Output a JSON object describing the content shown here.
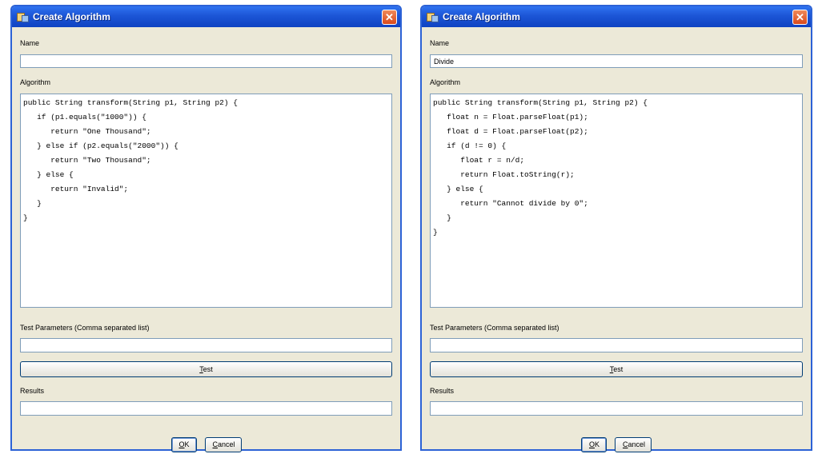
{
  "dialogs": [
    {
      "title": "Create Algorithm",
      "close_glyph": "✕",
      "name_label": "Name",
      "name_value": "",
      "algorithm_label": "Algorithm",
      "algorithm_code": "public String transform(String p1, String p2) {\n   if (p1.equals(\"1000\")) {\n      return \"One Thousand\";\n   } else if (p2.equals(\"2000\")) {\n      return \"Two Thousand\";\n   } else {\n      return \"Invalid\";\n   }\n}",
      "test_params_label": "Test Parameters (Comma separated list)",
      "test_params_value": "",
      "test_button": {
        "underlined": "T",
        "rest": "est"
      },
      "results_label": "Results",
      "results_value": "",
      "ok_button": {
        "underlined": "O",
        "rest": "K"
      },
      "cancel_button": {
        "underlined": "C",
        "rest": "ancel"
      }
    },
    {
      "title": "Create Algorithm",
      "close_glyph": "✕",
      "name_label": "Name",
      "name_value": "Divide",
      "algorithm_label": "Algorithm",
      "algorithm_code": "public String transform(String p1, String p2) {\n   float n = Float.parseFloat(p1);\n   float d = Float.parseFloat(p2);\n   if (d != 0) {\n      float r = n/d;\n      return Float.toString(r);\n   } else {\n      return \"Cannot divide by 0\";\n   }\n}",
      "test_params_label": "Test Parameters (Comma separated list)",
      "test_params_value": "",
      "test_button": {
        "underlined": "T",
        "rest": "est"
      },
      "results_label": "Results",
      "results_value": "",
      "ok_button": {
        "underlined": "O",
        "rest": "K"
      },
      "cancel_button": {
        "underlined": "C",
        "rest": "ancel"
      }
    }
  ],
  "icons": {
    "app": "folder-window-icon",
    "close": "close-icon"
  },
  "colors": {
    "titlebar": "#1c55d6",
    "dialog_bg": "#ece9d8",
    "close": "#d94a1c",
    "field_border": "#7f9db9"
  }
}
